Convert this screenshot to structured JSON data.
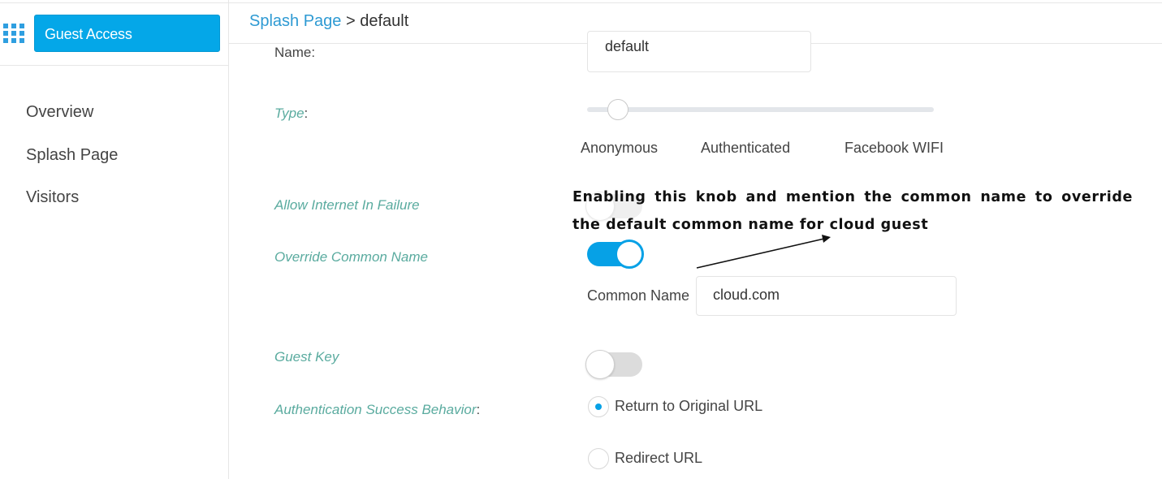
{
  "app": {
    "title": "Guest Access"
  },
  "sidebar": {
    "items": [
      {
        "label": "Overview"
      },
      {
        "label": "Splash Page"
      },
      {
        "label": "Visitors"
      }
    ]
  },
  "breadcrumb": {
    "parent": "Splash Page",
    "separator": ">",
    "current": "default"
  },
  "form": {
    "name": {
      "label": "Name:",
      "value": "default"
    },
    "type": {
      "label": "Type",
      "options": [
        "Anonymous",
        "Authenticated",
        "Facebook WIFI"
      ],
      "selected": "Anonymous"
    },
    "allow_internet": {
      "label": "Allow Internet In Failure",
      "enabled": false
    },
    "override_cn": {
      "label": "Override Common Name",
      "enabled": true
    },
    "common_name": {
      "label": "Common Name",
      "value": "cloud.com"
    },
    "guest_key": {
      "label": "Guest Key",
      "enabled": false
    },
    "auth_behavior": {
      "label": "Authentication Success Behavior",
      "options": [
        {
          "label": "Return to Original URL",
          "checked": true
        },
        {
          "label": "Redirect URL",
          "checked": false
        }
      ]
    }
  },
  "annotation": {
    "text": "Enabling this knob and mention the common name to override the default common name for cloud guest"
  },
  "colors": {
    "accent": "#04a7e8",
    "label": "#5aab9f",
    "link": "#2e9ad3"
  }
}
